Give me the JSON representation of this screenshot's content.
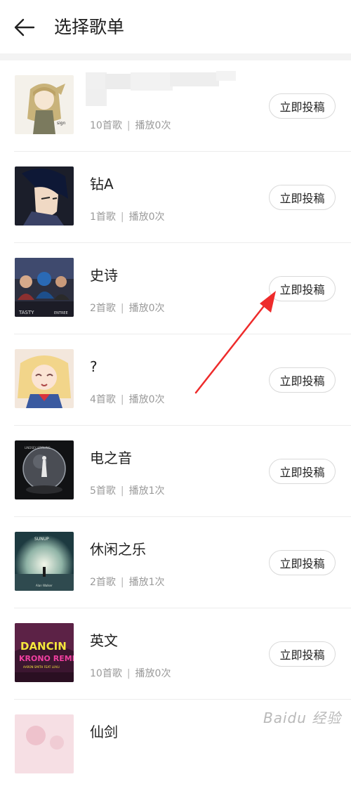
{
  "header": {
    "title": "选择歌单"
  },
  "submit_label": "立即投稿",
  "meta_separator": "|",
  "playlists": [
    {
      "name": "",
      "songs": "10首歌",
      "plays": "播放0次",
      "cover": "anime-girl-cover"
    },
    {
      "name": "钻A",
      "songs": "1首歌",
      "plays": "播放0次",
      "cover": "anime-boy-cover"
    },
    {
      "name": "史诗",
      "songs": "2首歌",
      "plays": "播放0次",
      "cover": "tasty-cover"
    },
    {
      "name": "?",
      "songs": "4首歌",
      "plays": "播放0次",
      "cover": "sailor-cover"
    },
    {
      "name": "电之音",
      "songs": "5首歌",
      "plays": "播放1次",
      "cover": "snowglobe-cover"
    },
    {
      "name": "休闲之乐",
      "songs": "2首歌",
      "plays": "播放1次",
      "cover": "sunrise-cover"
    },
    {
      "name": "英文",
      "songs": "10首歌",
      "plays": "播放0次",
      "cover": "dancin-cover"
    },
    {
      "name": "仙剑",
      "songs": "",
      "plays": "",
      "cover": "pink-cover"
    }
  ],
  "colors": {
    "annotation_arrow": "#ee2b2b",
    "divider": "#ececec",
    "meta_text": "#9a9a9a"
  },
  "watermark": "Baidu 经验"
}
